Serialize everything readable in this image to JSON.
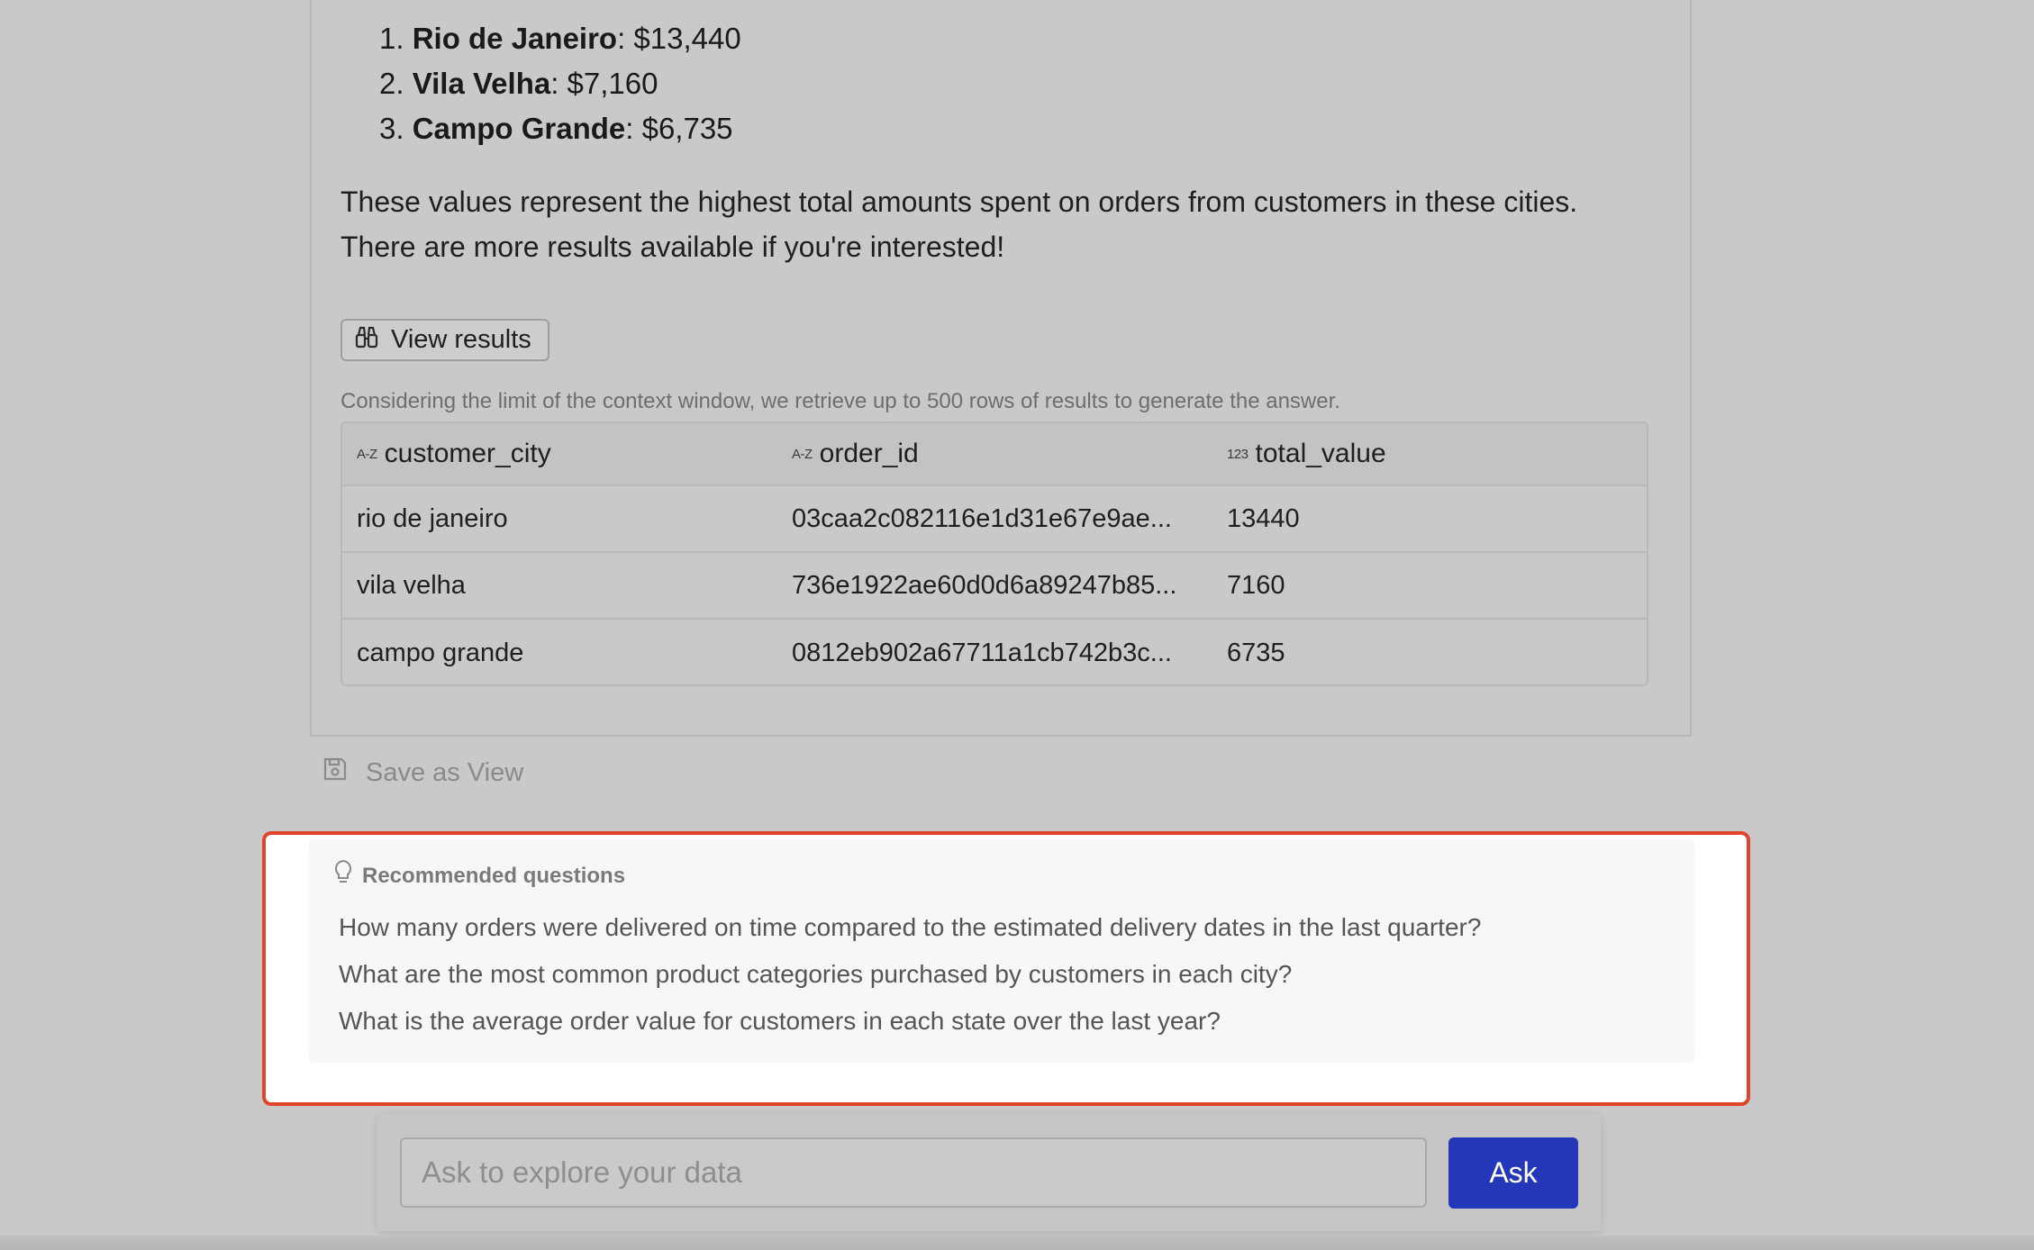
{
  "answer": {
    "ranked": [
      {
        "rank": "1.",
        "city": "Rio de Janeiro",
        "value": ": $13,440"
      },
      {
        "rank": "2.",
        "city": "Vila Velha",
        "value": ": $7,160"
      },
      {
        "rank": "3.",
        "city": "Campo Grande",
        "value": ": $6,735"
      }
    ],
    "paragraph_line1": "These values represent the highest total amounts spent on orders from customers in these cities.",
    "paragraph_line2": "There are more results available if you're interested!"
  },
  "view_results_label": "View results",
  "context_note": "Considering the limit of the context window, we retrieve up to 500 rows of results to generate the answer.",
  "table": {
    "columns": [
      {
        "type_icon": "A-Z",
        "name": "customer_city"
      },
      {
        "type_icon": "A-Z",
        "name": "order_id"
      },
      {
        "type_icon": "123",
        "name": "total_value"
      }
    ],
    "rows": [
      [
        "rio de janeiro",
        "03caa2c082116e1d31e67e9ae...",
        "13440"
      ],
      [
        "vila velha",
        "736e1922ae60d0d6a89247b85...",
        "7160"
      ],
      [
        "campo grande",
        "0812eb902a67711a1cb742b3c...",
        "6735"
      ]
    ]
  },
  "save_view_label": "Save as View",
  "recommended": {
    "title": "Recommended questions",
    "questions": [
      "How many orders were delivered on time compared to the estimated delivery dates in the last quarter?",
      "What are the most common product categories purchased by customers in each city?",
      "What is the average order value for customers in each state over the last year?"
    ]
  },
  "ask": {
    "placeholder": "Ask to explore your data",
    "button_label": "Ask"
  },
  "colors": {
    "highlight_border": "#e0452b",
    "ask_button": "#2437b8"
  }
}
